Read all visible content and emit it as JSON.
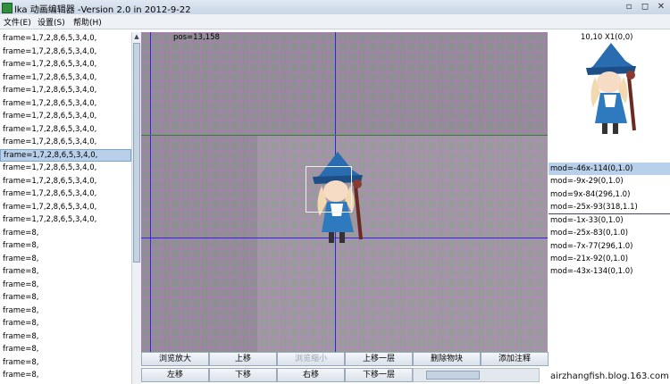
{
  "window": {
    "title": "lka 动画编辑器   -Version 2.0 in 2012-9-22",
    "controls": [
      "▫",
      "◻",
      "✕"
    ]
  },
  "menu": {
    "file": "文件(E)",
    "settings": "设置(S)",
    "help": "帮助(H)"
  },
  "frames": [
    "frame=1,7,2,8,6,5,3,4,0,",
    "frame=1,7,2,8,6,5,3,4,0,",
    "frame=1,7,2,8,6,5,3,4,0,",
    "frame=1,7,2,8,6,5,3,4,0,",
    "frame=1,7,2,8,6,5,3,4,0,",
    "frame=1,7,2,8,6,5,3,4,0,",
    "frame=1,7,2,8,6,5,3,4,0,",
    "frame=1,7,2,8,6,5,3,4,0,",
    "frame=1,7,2,8,6,5,3,4,0,",
    "frame=1,7,2,8,6,5,3,4,0,",
    "frame=1,7,2,8,6,5,3,4,0,",
    "frame=1,7,2,8,6,5,3,4,0,",
    "frame=1,7,2,8,6,5,3,4,0,",
    "frame=1,7,2,8,6,5,3,4,0,",
    "frame=1,7,2,8,6,5,3,4,0,",
    "frame=8,",
    "frame=8,",
    "frame=8,",
    "frame=8,",
    "frame=8,",
    "frame=8,",
    "frame=8,",
    "frame=8,",
    "frame=8,",
    "frame=8,",
    "frame=8,",
    "frame=8,"
  ],
  "canvas": {
    "pos_label": "pos=13,158"
  },
  "preview": {
    "label": "10,10 X1(0,0)"
  },
  "mods": [
    "mod=-46x-114(0,1.0)",
    "mod=-9x-29(0,1.0)",
    "mod=9x-84(296,1.0)",
    "mod=-25x-93(318,1.1)",
    "mod=-1x-33(0,1.0)",
    "mod=-25x-83(0,1.0)",
    "mod=-7x-77(296,1.0)",
    "mod=-21x-92(0,1.0)",
    "mod=-43x-134(0,1.0)"
  ],
  "buttons": {
    "row1": [
      "浏览放大",
      "上移",
      "浏览缩小",
      "上移一层",
      "删除物块",
      "添加注释"
    ],
    "row2": [
      "左移",
      "下移",
      "右移",
      "下移一层"
    ]
  },
  "watermark": "airzhangfish.blog.163.com",
  "colors": {
    "canvas_bg": "#8e8e94",
    "grid": "#b07ab6",
    "axis": "#2a2ae0",
    "selection": "#b8d0ea"
  }
}
